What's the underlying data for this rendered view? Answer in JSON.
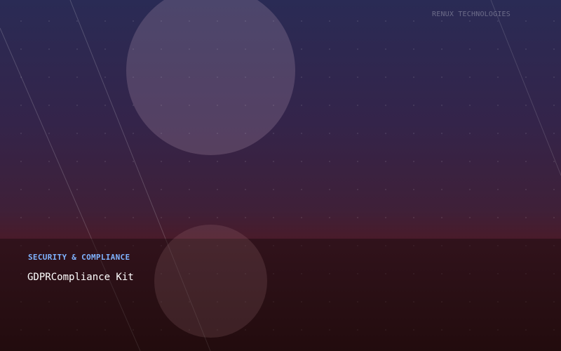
{
  "brand": {
    "name": "RENUX TECHNOLOGIES"
  },
  "hero": {
    "category": "SECURITY & COMPLIANCE",
    "title": "GDPRCompliance Kit"
  },
  "colors": {
    "accent": "#7fb3ff",
    "title_text": "#ffffff",
    "gradient_top": "#2a2b55",
    "gradient_bottom": "#2f0f10"
  }
}
